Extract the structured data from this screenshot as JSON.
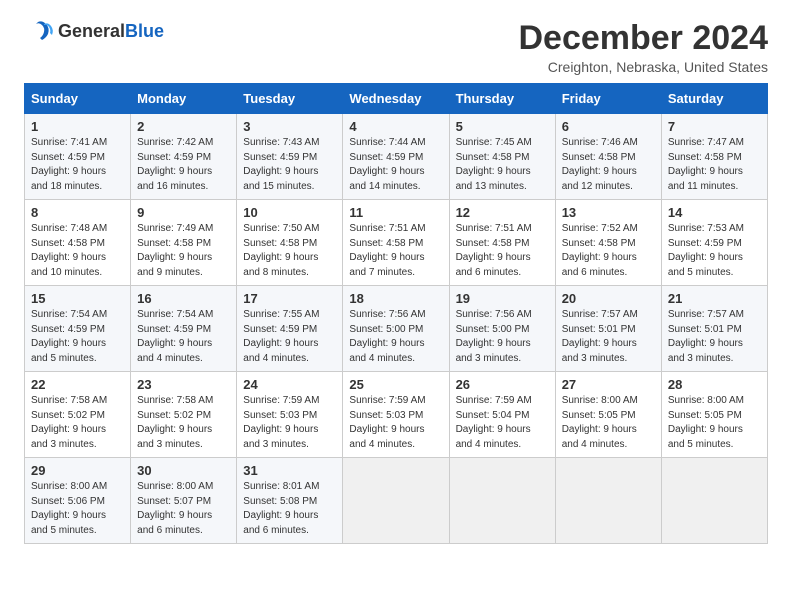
{
  "header": {
    "logo_general": "General",
    "logo_blue": "Blue",
    "month_title": "December 2024",
    "location": "Creighton, Nebraska, United States"
  },
  "weekdays": [
    "Sunday",
    "Monday",
    "Tuesday",
    "Wednesday",
    "Thursday",
    "Friday",
    "Saturday"
  ],
  "weeks": [
    [
      {
        "day": "1",
        "info": "Sunrise: 7:41 AM\nSunset: 4:59 PM\nDaylight: 9 hours and 18 minutes."
      },
      {
        "day": "2",
        "info": "Sunrise: 7:42 AM\nSunset: 4:59 PM\nDaylight: 9 hours and 16 minutes."
      },
      {
        "day": "3",
        "info": "Sunrise: 7:43 AM\nSunset: 4:59 PM\nDaylight: 9 hours and 15 minutes."
      },
      {
        "day": "4",
        "info": "Sunrise: 7:44 AM\nSunset: 4:59 PM\nDaylight: 9 hours and 14 minutes."
      },
      {
        "day": "5",
        "info": "Sunrise: 7:45 AM\nSunset: 4:58 PM\nDaylight: 9 hours and 13 minutes."
      },
      {
        "day": "6",
        "info": "Sunrise: 7:46 AM\nSunset: 4:58 PM\nDaylight: 9 hours and 12 minutes."
      },
      {
        "day": "7",
        "info": "Sunrise: 7:47 AM\nSunset: 4:58 PM\nDaylight: 9 hours and 11 minutes."
      }
    ],
    [
      {
        "day": "8",
        "info": "Sunrise: 7:48 AM\nSunset: 4:58 PM\nDaylight: 9 hours and 10 minutes."
      },
      {
        "day": "9",
        "info": "Sunrise: 7:49 AM\nSunset: 4:58 PM\nDaylight: 9 hours and 9 minutes."
      },
      {
        "day": "10",
        "info": "Sunrise: 7:50 AM\nSunset: 4:58 PM\nDaylight: 9 hours and 8 minutes."
      },
      {
        "day": "11",
        "info": "Sunrise: 7:51 AM\nSunset: 4:58 PM\nDaylight: 9 hours and 7 minutes."
      },
      {
        "day": "12",
        "info": "Sunrise: 7:51 AM\nSunset: 4:58 PM\nDaylight: 9 hours and 6 minutes."
      },
      {
        "day": "13",
        "info": "Sunrise: 7:52 AM\nSunset: 4:58 PM\nDaylight: 9 hours and 6 minutes."
      },
      {
        "day": "14",
        "info": "Sunrise: 7:53 AM\nSunset: 4:59 PM\nDaylight: 9 hours and 5 minutes."
      }
    ],
    [
      {
        "day": "15",
        "info": "Sunrise: 7:54 AM\nSunset: 4:59 PM\nDaylight: 9 hours and 5 minutes."
      },
      {
        "day": "16",
        "info": "Sunrise: 7:54 AM\nSunset: 4:59 PM\nDaylight: 9 hours and 4 minutes."
      },
      {
        "day": "17",
        "info": "Sunrise: 7:55 AM\nSunset: 4:59 PM\nDaylight: 9 hours and 4 minutes."
      },
      {
        "day": "18",
        "info": "Sunrise: 7:56 AM\nSunset: 5:00 PM\nDaylight: 9 hours and 4 minutes."
      },
      {
        "day": "19",
        "info": "Sunrise: 7:56 AM\nSunset: 5:00 PM\nDaylight: 9 hours and 3 minutes."
      },
      {
        "day": "20",
        "info": "Sunrise: 7:57 AM\nSunset: 5:01 PM\nDaylight: 9 hours and 3 minutes."
      },
      {
        "day": "21",
        "info": "Sunrise: 7:57 AM\nSunset: 5:01 PM\nDaylight: 9 hours and 3 minutes."
      }
    ],
    [
      {
        "day": "22",
        "info": "Sunrise: 7:58 AM\nSunset: 5:02 PM\nDaylight: 9 hours and 3 minutes."
      },
      {
        "day": "23",
        "info": "Sunrise: 7:58 AM\nSunset: 5:02 PM\nDaylight: 9 hours and 3 minutes."
      },
      {
        "day": "24",
        "info": "Sunrise: 7:59 AM\nSunset: 5:03 PM\nDaylight: 9 hours and 3 minutes."
      },
      {
        "day": "25",
        "info": "Sunrise: 7:59 AM\nSunset: 5:03 PM\nDaylight: 9 hours and 4 minutes."
      },
      {
        "day": "26",
        "info": "Sunrise: 7:59 AM\nSunset: 5:04 PM\nDaylight: 9 hours and 4 minutes."
      },
      {
        "day": "27",
        "info": "Sunrise: 8:00 AM\nSunset: 5:05 PM\nDaylight: 9 hours and 4 minutes."
      },
      {
        "day": "28",
        "info": "Sunrise: 8:00 AM\nSunset: 5:05 PM\nDaylight: 9 hours and 5 minutes."
      }
    ],
    [
      {
        "day": "29",
        "info": "Sunrise: 8:00 AM\nSunset: 5:06 PM\nDaylight: 9 hours and 5 minutes."
      },
      {
        "day": "30",
        "info": "Sunrise: 8:00 AM\nSunset: 5:07 PM\nDaylight: 9 hours and 6 minutes."
      },
      {
        "day": "31",
        "info": "Sunrise: 8:01 AM\nSunset: 5:08 PM\nDaylight: 9 hours and 6 minutes."
      },
      null,
      null,
      null,
      null
    ]
  ]
}
